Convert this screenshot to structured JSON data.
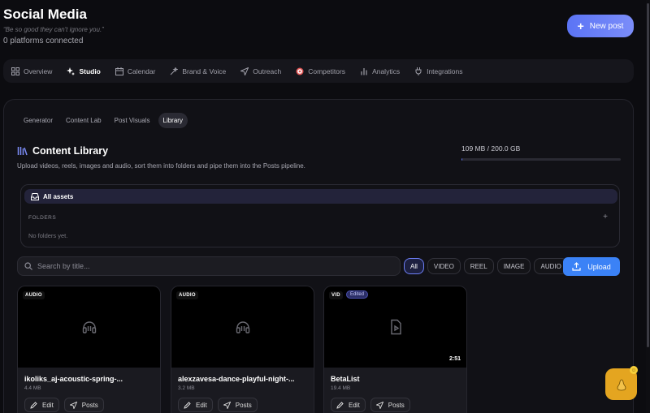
{
  "app": {
    "title": "Social Media",
    "tagline": "“Be so good they can't ignore you.”",
    "platforms": "0 platforms connected",
    "new_post_label": "New post"
  },
  "nav": {
    "items": [
      {
        "label": "Overview",
        "icon": "grid-icon"
      },
      {
        "label": "Studio",
        "icon": "sparkles-icon",
        "active": true
      },
      {
        "label": "Calendar",
        "icon": "calendar-icon"
      },
      {
        "label": "Brand & Voice",
        "icon": "wand-icon"
      },
      {
        "label": "Outreach",
        "icon": "send-icon"
      },
      {
        "label": "Competitors",
        "icon": "target-icon"
      },
      {
        "label": "Analytics",
        "icon": "bar-chart-icon"
      },
      {
        "label": "Integrations",
        "icon": "plug-icon"
      }
    ]
  },
  "subtabs": [
    "Generator",
    "Content Lab",
    "Post Visuals",
    "Library"
  ],
  "library": {
    "title": "Content Library",
    "description": "Upload videos, reels, images and audio, sort them into folders and pipe them into the Posts pipeline.",
    "storage_text": "109 MB / 200.0 GB",
    "storage_fraction": 0.0005,
    "all_assets": "All assets",
    "folders_label": "FOLDERS",
    "folders_add": "+",
    "no_folders": "No folders yet.",
    "search_placeholder": "Search by title...",
    "filters": [
      "All",
      "VIDEO",
      "REEL",
      "IMAGE",
      "AUDIO"
    ],
    "active_filter": "All",
    "upload_label": "Upload"
  },
  "assets": [
    {
      "type": "AUDIO",
      "title": "ikoliks_aj-acoustic-spring-...",
      "size": "4.4 MB",
      "icon": "music-file-icon"
    },
    {
      "type": "AUDIO",
      "title": "alexzavesa-dance-playful-night-...",
      "size": "3.2 MB",
      "icon": "music-file-icon"
    },
    {
      "type": "VID",
      "badge": "Edited",
      "title": "BetaList",
      "size": "19.4 MB",
      "duration": "2:51",
      "icon": "video-file-icon"
    }
  ],
  "card_actions": {
    "edit": "Edit",
    "posts": "Posts"
  },
  "fab": {
    "icon": "pear-icon"
  },
  "colors": {
    "accent": "#5b74f5",
    "upload": "#3b82f6",
    "fab": "#e4a520",
    "background": "#0c0c10"
  }
}
